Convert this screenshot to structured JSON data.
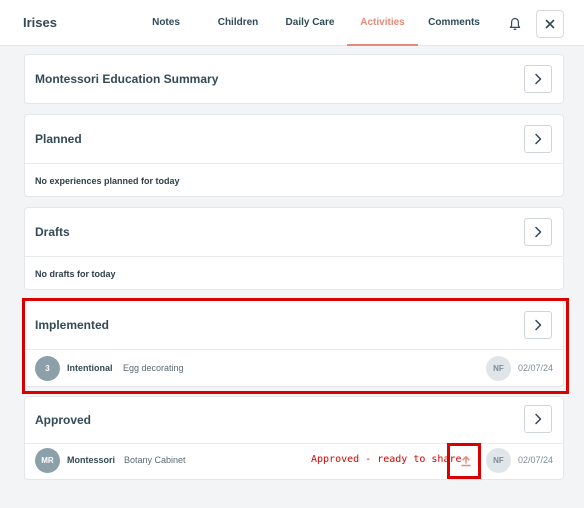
{
  "header": {
    "title": "Irises",
    "tabs": [
      {
        "label": "Notes"
      },
      {
        "label": "Children"
      },
      {
        "label": "Daily Care"
      },
      {
        "label": "Activities"
      },
      {
        "label": "Comments"
      }
    ],
    "active_tab": "Activities",
    "bell_icon": "bell-icon",
    "close_icon": "close-icon"
  },
  "cards": {
    "summary": {
      "title": "Montessori Education Summary"
    },
    "planned": {
      "title": "Planned",
      "empty_text": "No experiences planned for today"
    },
    "drafts": {
      "title": "Drafts",
      "empty_text": "No drafts for today"
    },
    "implemented": {
      "title": "Implemented",
      "row": {
        "badge": "3",
        "type": "Intentional",
        "name": "Egg decorating",
        "staff": "NF",
        "date": "02/07/24"
      }
    },
    "approved": {
      "title": "Approved",
      "row": {
        "badge": "MR",
        "type": "Montessori",
        "name": "Botany Cabinet",
        "staff": "NF",
        "date": "02/07/24",
        "share_icon": "upload-icon"
      },
      "annotation": "Approved - ready to share"
    }
  },
  "colors": {
    "accent": "#e58b7a",
    "highlight": "#d90000",
    "text": "#334a57"
  }
}
